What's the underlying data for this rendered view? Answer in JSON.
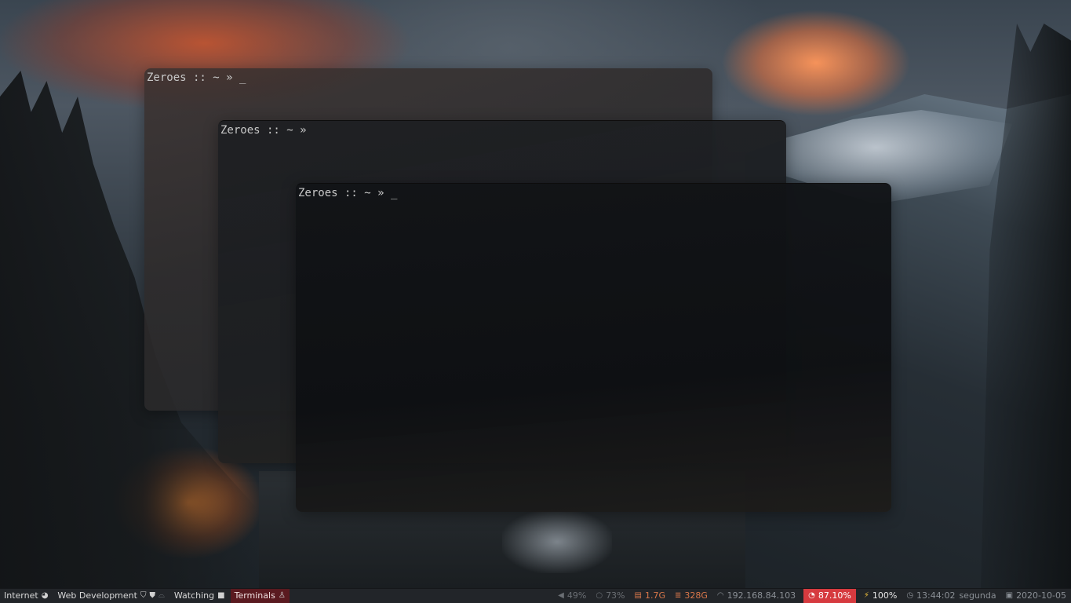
{
  "terminals": [
    {
      "prompt": "Zeroes :: ~ » _"
    },
    {
      "prompt": "Zeroes :: ~ »"
    },
    {
      "prompt": "Zeroes :: ~ » _"
    }
  ],
  "taskbar": {
    "workspaces": [
      {
        "label": "Internet",
        "icons": [
          "pie-chart-icon"
        ],
        "active": false
      },
      {
        "label": "Web Development",
        "icons": [
          "html5-icon",
          "css3-icon",
          "gamepad-icon"
        ],
        "active": false
      },
      {
        "label": "Watching",
        "icons": [
          "video-camera-icon"
        ],
        "active": false
      },
      {
        "label": "Terminals",
        "icons": [
          "linux-icon"
        ],
        "active": true
      }
    ],
    "status": {
      "volume": "49%",
      "brightness": "73%",
      "memory": "1.7G",
      "disk": "328G",
      "ip": "192.168.84.103",
      "cpu": "87.10%",
      "battery": "100%",
      "time": "13:44:02",
      "weekday": "segunda",
      "date": "2020-10-05"
    },
    "colors": {
      "accent": "#d63a3f",
      "active_workspace": "#5a1a20",
      "warning": "#d9774a",
      "battery": "#f2c23c"
    }
  }
}
